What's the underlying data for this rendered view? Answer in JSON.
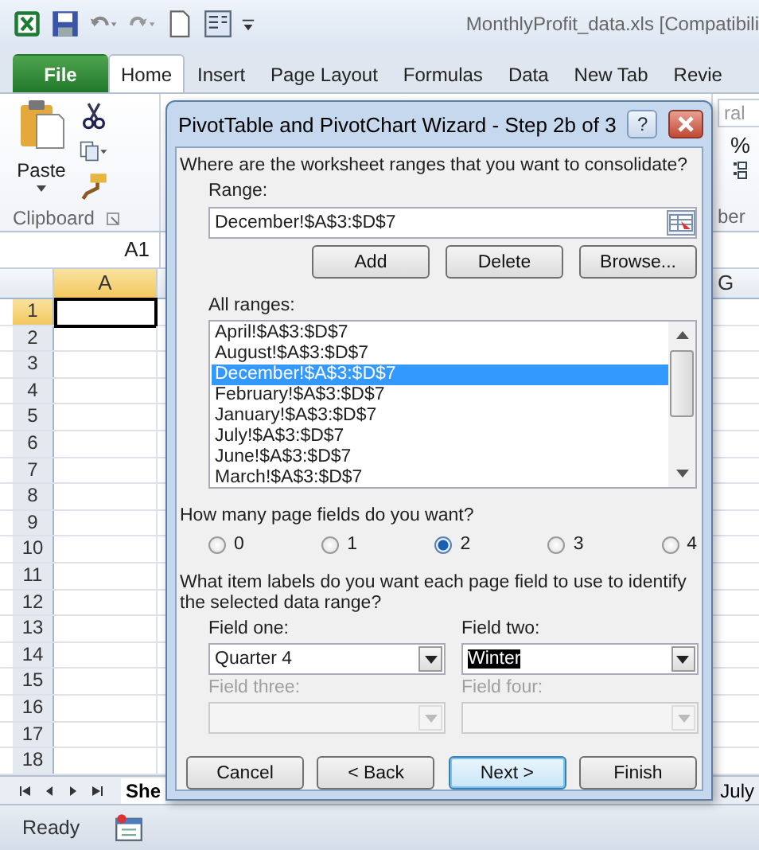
{
  "window": {
    "title": "MonthlyProfit_data.xls  [Compatibili"
  },
  "ribbon_tabs": [
    {
      "label": "File",
      "kind": "file",
      "selected": false
    },
    {
      "label": "Home",
      "kind": "tab",
      "selected": true
    },
    {
      "label": "Insert",
      "kind": "tab",
      "selected": false
    },
    {
      "label": "Page Layout",
      "kind": "tab",
      "selected": false
    },
    {
      "label": "Formulas",
      "kind": "tab",
      "selected": false
    },
    {
      "label": "Data",
      "kind": "tab",
      "selected": false
    },
    {
      "label": "New Tab",
      "kind": "tab",
      "selected": false
    },
    {
      "label": "Revie",
      "kind": "tab",
      "selected": false
    }
  ],
  "ribbon": {
    "paste": "Paste",
    "clipboard_group": "Clipboard",
    "number_format": "ral",
    "percent": "%",
    "number_group": "ber"
  },
  "name_box": "A1",
  "grid": {
    "column_headers": [
      {
        "label": "A",
        "selected": true
      },
      {
        "label": "G",
        "selected": false
      }
    ],
    "rows": [
      {
        "label": "1",
        "selected": true
      },
      {
        "label": "2",
        "selected": false
      },
      {
        "label": "3",
        "selected": false
      },
      {
        "label": "4",
        "selected": false
      },
      {
        "label": "5",
        "selected": false
      },
      {
        "label": "6",
        "selected": false
      },
      {
        "label": "7",
        "selected": false
      },
      {
        "label": "8",
        "selected": false
      },
      {
        "label": "9",
        "selected": false
      },
      {
        "label": "10",
        "selected": false
      },
      {
        "label": "11",
        "selected": false
      },
      {
        "label": "12",
        "selected": false
      },
      {
        "label": "13",
        "selected": false
      },
      {
        "label": "14",
        "selected": false
      },
      {
        "label": "15",
        "selected": false
      },
      {
        "label": "16",
        "selected": false
      },
      {
        "label": "17",
        "selected": false
      },
      {
        "label": "18",
        "selected": false
      }
    ]
  },
  "sheet_tabs": [
    {
      "label": "She",
      "selected": true
    },
    {
      "label": "July",
      "selected": false
    }
  ],
  "status_bar": {
    "text": "Ready"
  },
  "dialog": {
    "title": "PivotTable and PivotChart Wizard - Step 2b of 3",
    "help": "?",
    "prompt": "Where are the worksheet ranges that you want to consolidate?",
    "range_label": {
      "label": "Range:"
    },
    "range_value": "December!$A$3:$D$7",
    "range_buttons": [
      {
        "label": "Add"
      },
      {
        "label": "Delete"
      },
      {
        "label": "Browse..."
      }
    ],
    "all_ranges_label": {
      "label": "All ranges:"
    },
    "ranges": [
      {
        "text": "April!$A$3:$D$7",
        "selected": false
      },
      {
        "text": "August!$A$3:$D$7",
        "selected": false
      },
      {
        "text": "December!$A$3:$D$7",
        "selected": true
      },
      {
        "text": "February!$A$3:$D$7",
        "selected": false
      },
      {
        "text": "January!$A$3:$D$7",
        "selected": false
      },
      {
        "text": "July!$A$3:$D$7",
        "selected": false
      },
      {
        "text": "June!$A$3:$D$7",
        "selected": false
      },
      {
        "text": "March!$A$3:$D$7",
        "selected": false
      }
    ],
    "page_fields_question": "How many page fields do you want?",
    "page_field_options": [
      {
        "label": "0",
        "selected": false
      },
      {
        "label": "1",
        "selected": false
      },
      {
        "label": "2",
        "selected": true
      },
      {
        "label": "3",
        "selected": false
      },
      {
        "label": "4",
        "selected": false
      }
    ],
    "item_labels_question": "What item labels do you want each page field to use to identify the selected data range?",
    "fields": [
      {
        "label": "Field one:",
        "value": "Quarter 4",
        "disabled": false,
        "focused": false
      },
      {
        "label": "Field two:",
        "value": "Winter",
        "disabled": false,
        "focused": true
      },
      {
        "label": "Field three:",
        "disabled": true
      },
      {
        "label": "Field four:",
        "disabled": true
      }
    ],
    "footer_buttons": [
      {
        "label": "Cancel",
        "default": false
      },
      {
        "label": "< Back",
        "default": false
      },
      {
        "label": "Next >",
        "default": true
      },
      {
        "label": "Finish",
        "default": false
      }
    ]
  }
}
